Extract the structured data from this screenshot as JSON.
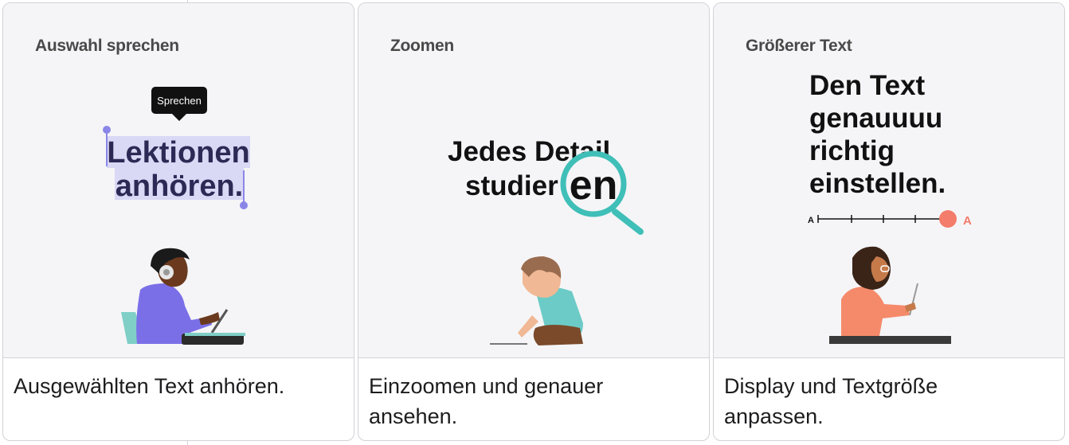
{
  "cards": [
    {
      "tag": "Auswahl sprechen",
      "tooltip": "Sprechen",
      "headline_line1": "Lektionen",
      "headline_line2": "anhören.",
      "caption": "Ausgewählten Text anhören."
    },
    {
      "tag": "Zoomen",
      "headline_line1": "Jedes Detail",
      "headline_line2": "studier",
      "magnified": "en",
      "caption_line1": "Einzoomen und genauer",
      "caption_line2": "ansehen."
    },
    {
      "tag": "Größerer Text",
      "headline_lines": [
        "Den Text",
        "genauuuu",
        "richtig",
        "einstellen."
      ],
      "slider_min_label": "A",
      "slider_max_label": "A",
      "slider_value": 1.0,
      "caption_line1": "Display und Textgröße",
      "caption_line2": "anpassen."
    }
  ],
  "colors": {
    "selection": "#d9d8f5",
    "selection_handle": "#8a86e8",
    "magnifier": "#3fbfb8",
    "slider_thumb": "#f47c6a",
    "card_bg": "#f5f5f7"
  }
}
